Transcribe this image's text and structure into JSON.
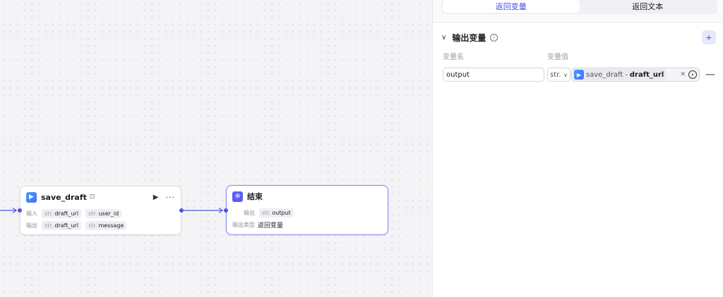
{
  "canvas": {
    "nodes": [
      {
        "id": "save-draft",
        "title": "save_draft",
        "input_label": "输入",
        "output_label": "输出",
        "inputs": [
          {
            "type": "str.",
            "name": "draft_url"
          },
          {
            "type": "str.",
            "name": "user_id"
          }
        ],
        "outputs": [
          {
            "type": "str.",
            "name": "draft_url"
          },
          {
            "type": "str.",
            "name": "message"
          }
        ]
      },
      {
        "id": "end",
        "title": "结束",
        "output_label": "输出",
        "outputs": [
          {
            "type": "str.",
            "name": "output"
          }
        ],
        "output_type_label": "输出类型",
        "output_type_value": "返回变量"
      }
    ]
  },
  "panel": {
    "tabs": [
      {
        "label": "返回变量",
        "active": true
      },
      {
        "label": "返回文本",
        "active": false
      }
    ],
    "section_title": "输出变量",
    "add_label": "+",
    "col_name_label": "变量名",
    "col_value_label": "变量值",
    "variables": [
      {
        "name": "output",
        "type": "str.",
        "ref_node": "save_draft",
        "ref_sep": "-",
        "ref_var": "draft_url"
      }
    ],
    "remove_label": "—"
  },
  "colors": {
    "accent": "#4a4ce0",
    "edge": "#4f51e0",
    "selected_border": "#8b8cf0"
  }
}
